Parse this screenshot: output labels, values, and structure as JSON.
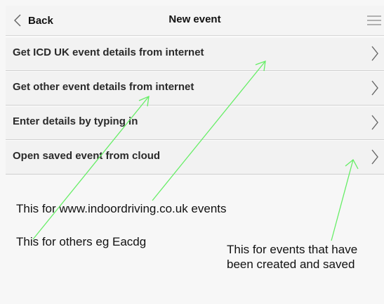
{
  "header": {
    "back_label": "Back",
    "title": "New event",
    "back_icon": "chevron-left-icon",
    "menu_icon": "hamburger-menu-icon"
  },
  "options": [
    {
      "label": "Get ICD UK event details from internet",
      "icon": "chevron-right-icon"
    },
    {
      "label": "Get other event details from internet",
      "icon": "chevron-right-icon"
    },
    {
      "label": "Enter details by typing in",
      "icon": "chevron-right-icon"
    },
    {
      "label": "Open saved event from cloud",
      "icon": "chevron-right-icon"
    }
  ],
  "annotations": {
    "note1": "This for www.indoordriving.co.uk events",
    "note2": "This for others eg Eacdg",
    "note3_line1": "This for events that have",
    "note3_line2": "been created and saved"
  },
  "colors": {
    "annotation_arrow": "#66ee66",
    "background": "#f7f7f7",
    "row_background": "#f2f2f2"
  }
}
